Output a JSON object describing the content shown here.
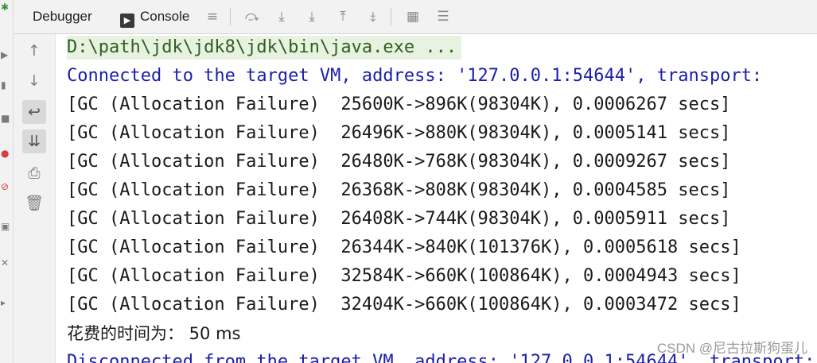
{
  "tabs": {
    "debugger": "Debugger",
    "console": "Console"
  },
  "console_lines": [
    "D:\\path\\jdk\\jdk8\\jdk\\bin\\java.exe ...",
    "Connected to the target VM, address: '127.0.0.1:54644', transport:",
    "[GC (Allocation Failure)  25600K->896K(98304K), 0.0006267 secs]",
    "[GC (Allocation Failure)  26496K->880K(98304K), 0.0005141 secs]",
    "[GC (Allocation Failure)  26480K->768K(98304K), 0.0009267 secs]",
    "[GC (Allocation Failure)  26368K->808K(98304K), 0.0004585 secs]",
    "[GC (Allocation Failure)  26408K->744K(98304K), 0.0005911 secs]",
    "[GC (Allocation Failure)  26344K->840K(101376K), 0.0005618 secs]",
    "[GC (Allocation Failure)  32584K->660K(100864K), 0.0004943 secs]",
    "[GC (Allocation Failure)  32404K->660K(100864K), 0.0003472 secs]",
    "花费的时间为： 50 ms",
    "Disconnected from the target VM, address: '127.0.0.1:54644', transport:"
  ],
  "watermark": "CSDN @尼古拉斯狗蛋儿"
}
